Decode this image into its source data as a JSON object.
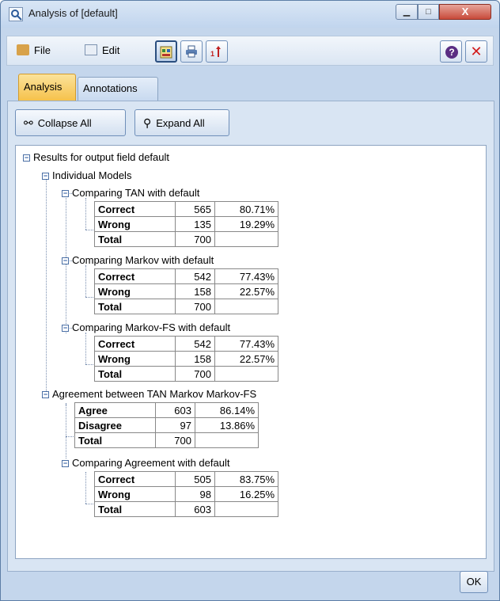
{
  "window": {
    "title": "Analysis of [default]",
    "controls": {
      "minimize": "▁",
      "maximize": "□",
      "close": "X"
    }
  },
  "toolbar": {
    "file_label": "File",
    "edit_label": "Edit",
    "help_label": "?",
    "close_label": "✕"
  },
  "tabs": [
    {
      "label": "Analysis",
      "selected": true
    },
    {
      "label": "Annotations",
      "selected": false
    }
  ],
  "buttons": {
    "collapse_all": "Collapse All",
    "expand_all": "Expand All",
    "ok": "OK"
  },
  "tree": {
    "root": "Results for output field default",
    "individual_models": "Individual Models",
    "comparisons": [
      {
        "title": "Comparing TAN with default",
        "rows": [
          {
            "label": "Correct",
            "count": "565",
            "pct": "80.71%"
          },
          {
            "label": "Wrong",
            "count": "135",
            "pct": "19.29%"
          },
          {
            "label": "Total",
            "count": "700",
            "pct": ""
          }
        ]
      },
      {
        "title": "Comparing Markov with default",
        "rows": [
          {
            "label": "Correct",
            "count": "542",
            "pct": "77.43%"
          },
          {
            "label": "Wrong",
            "count": "158",
            "pct": "22.57%"
          },
          {
            "label": "Total",
            "count": "700",
            "pct": ""
          }
        ]
      },
      {
        "title": "Comparing Markov-FS with default",
        "rows": [
          {
            "label": "Correct",
            "count": "542",
            "pct": "77.43%"
          },
          {
            "label": "Wrong",
            "count": "158",
            "pct": "22.57%"
          },
          {
            "label": "Total",
            "count": "700",
            "pct": ""
          }
        ]
      }
    ],
    "agreement": {
      "title": "Agreement between  TAN Markov Markov-FS",
      "rows": [
        {
          "label": "Agree",
          "count": "603",
          "pct": "86.14%"
        },
        {
          "label": "Disagree",
          "count": "97",
          "pct": "13.86%"
        },
        {
          "label": "Total",
          "count": "700",
          "pct": ""
        }
      ]
    },
    "agreement_compare": {
      "title": "Comparing Agreement with default",
      "rows": [
        {
          "label": "Correct",
          "count": "505",
          "pct": "83.75%"
        },
        {
          "label": "Wrong",
          "count": "98",
          "pct": "16.25%"
        },
        {
          "label": "Total",
          "count": "603",
          "pct": ""
        }
      ]
    }
  }
}
